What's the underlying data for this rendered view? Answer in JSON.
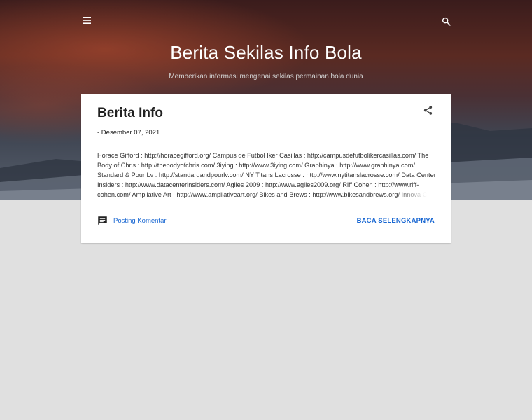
{
  "header": {
    "menu_icon": "hamburger-menu-icon",
    "search_icon": "search-icon",
    "title": "Berita Sekilas Info Bola",
    "description": "Memberikan informasi mengenai sekilas permainan bola dunia"
  },
  "post": {
    "title": "Berita Info",
    "share_icon": "share-icon",
    "date": "- Desember 07, 2021",
    "snippet": "Horace Gifford : http://horacegifford.org/ Campus de Futbol Iker Casillas : http://campusdefutbolikercasillas.com/ The Body of Chris : http://thebodyofchris.com/ 3iying : http://www.3iying.com/ Graphinya : http://www.graphinya.com/ Standard & Pour Lv : http://standardandpourlv.com/ NY Titans Lacrosse : http://www.nytitanslacrosse.com/ Data Center Insiders : http://www.datacenterinsiders.com/ Agiles 2009 : http://www.agiles2009.org/ Riff Cohen : http://www.riff-cohen.com/ Ampliative Art : http://www.ampliativeart.org/ Bikes and Brews : http://www.bikesandbrews.org/ Innova Ch",
    "ellipsis": "…",
    "comment_icon": "comment-icon",
    "comment_label": "Posting Komentar",
    "read_more_label": "BACA SELENGKAPNYA"
  },
  "colors": {
    "link": "#1967d2",
    "page_background": "#e0e0e0",
    "card_background": "#ffffff"
  }
}
